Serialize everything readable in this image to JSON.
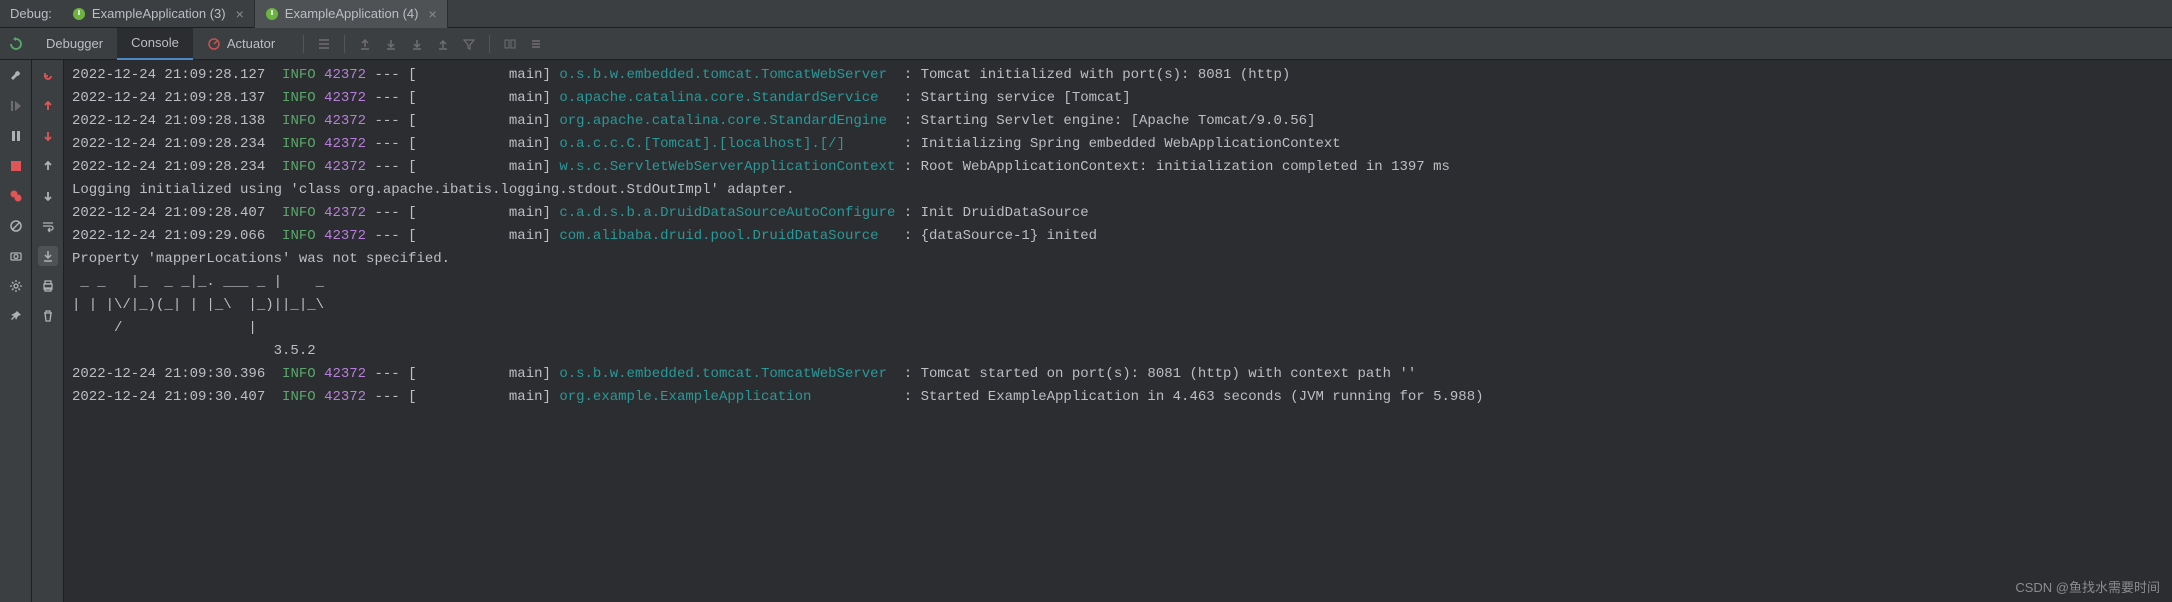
{
  "topbar": {
    "debug_label": "Debug:",
    "tabs": [
      {
        "label": "ExampleApplication (3)"
      },
      {
        "label": "ExampleApplication (4)"
      }
    ]
  },
  "tabs": {
    "debugger": "Debugger",
    "console": "Console",
    "actuator": "Actuator"
  },
  "log": {
    "lines": [
      {
        "ts": "2022-12-24 21:09:28.127",
        "level": "INFO",
        "pid": "42372",
        "thread": "main",
        "logger": "o.s.b.w.embedded.tomcat.TomcatWebServer",
        "msg": "Tomcat initialized with port(s): 8081 (http)"
      },
      {
        "ts": "2022-12-24 21:09:28.137",
        "level": "INFO",
        "pid": "42372",
        "thread": "main",
        "logger": "o.apache.catalina.core.StandardService",
        "msg": "Starting service [Tomcat]"
      },
      {
        "ts": "2022-12-24 21:09:28.138",
        "level": "INFO",
        "pid": "42372",
        "thread": "main",
        "logger": "org.apache.catalina.core.StandardEngine",
        "msg": "Starting Servlet engine: [Apache Tomcat/9.0.56]"
      },
      {
        "ts": "2022-12-24 21:09:28.234",
        "level": "INFO",
        "pid": "42372",
        "thread": "main",
        "logger": "o.a.c.c.C.[Tomcat].[localhost].[/]",
        "msg": "Initializing Spring embedded WebApplicationContext"
      },
      {
        "ts": "2022-12-24 21:09:28.234",
        "level": "INFO",
        "pid": "42372",
        "thread": "main",
        "logger": "w.s.c.ServletWebServerApplicationContext",
        "msg": "Root WebApplicationContext: initialization completed in 1397 ms"
      }
    ],
    "plain1": "Logging initialized using 'class org.apache.ibatis.logging.stdout.StdOutImpl' adapter.",
    "lines2": [
      {
        "ts": "2022-12-24 21:09:28.407",
        "level": "INFO",
        "pid": "42372",
        "thread": "main",
        "logger": "c.a.d.s.b.a.DruidDataSourceAutoConfigure",
        "msg": "Init DruidDataSource"
      },
      {
        "ts": "2022-12-24 21:09:29.066",
        "level": "INFO",
        "pid": "42372",
        "thread": "main",
        "logger": "com.alibaba.druid.pool.DruidDataSource",
        "msg": "{dataSource-1} inited"
      }
    ],
    "plain2": "Property 'mapperLocations' was not specified.",
    "ascii1": " _ _   |_  _ _|_. ___ _ |    _ ",
    "ascii2": "| | |\\/|_)(_| | |_\\  |_)||_|_\\ ",
    "ascii3": "     /               |         ",
    "version": "                        3.5.2 ",
    "lines3": [
      {
        "ts": "2022-12-24 21:09:30.396",
        "level": "INFO",
        "pid": "42372",
        "thread": "main",
        "logger": "o.s.b.w.embedded.tomcat.TomcatWebServer",
        "msg": "Tomcat started on port(s): 8081 (http) with context path ''"
      },
      {
        "ts": "2022-12-24 21:09:30.407",
        "level": "INFO",
        "pid": "42372",
        "thread": "main",
        "logger": "org.example.ExampleApplication",
        "msg": "Started ExampleApplication in 4.463 seconds (JVM running for 5.988)"
      }
    ]
  },
  "watermark": "CSDN @鱼找水需要时间"
}
